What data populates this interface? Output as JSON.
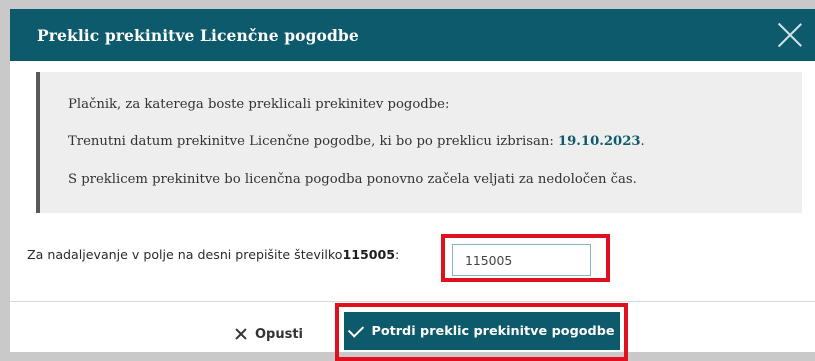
{
  "dialog": {
    "title": "Preklic prekinitve Licenčne pogodbe",
    "close_icon": "close-icon"
  },
  "info": {
    "line1": "Plačnik, za katerega boste preklicali prekinitev pogodbe:",
    "line2_prefix": "Trenutni datum prekinitve Licenčne pogodbe, ki bo po preklicu izbrisan: ",
    "line2_date": "19.10.2023",
    "line2_suffix": ".",
    "line3": "S preklicem prekinitve bo licenčna pogodba ponovno začela veljati za nedoločen čas."
  },
  "confirm": {
    "label_prefix": "Za nadaljevanje v polje na desni prepišite številko ",
    "code": "115005",
    "label_suffix": ":",
    "input_value": "115005"
  },
  "buttons": {
    "cancel_label": "Opusti",
    "cancel_icon": "x-icon",
    "confirm_label": "Potrdi preklic prekinitve pogodbe",
    "confirm_icon": "check-icon"
  },
  "colors": {
    "header": "#0d5a6c",
    "highlight": "#e0101c",
    "link": "#0d5a6c"
  }
}
